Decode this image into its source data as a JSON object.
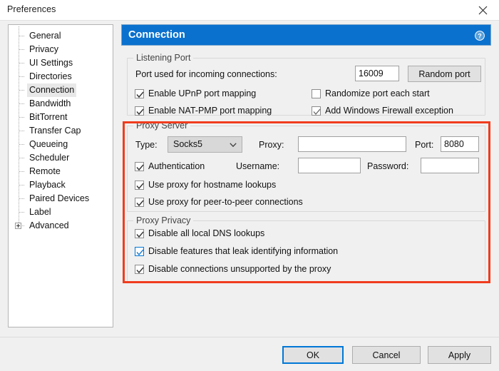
{
  "window": {
    "title": "Preferences",
    "close_icon": "close-icon"
  },
  "sidebar": {
    "items": [
      {
        "label": "General",
        "selected": false,
        "expandable": false
      },
      {
        "label": "Privacy",
        "selected": false,
        "expandable": false
      },
      {
        "label": "UI Settings",
        "selected": false,
        "expandable": false
      },
      {
        "label": "Directories",
        "selected": false,
        "expandable": false
      },
      {
        "label": "Connection",
        "selected": true,
        "expandable": false
      },
      {
        "label": "Bandwidth",
        "selected": false,
        "expandable": false
      },
      {
        "label": "BitTorrent",
        "selected": false,
        "expandable": false
      },
      {
        "label": "Transfer Cap",
        "selected": false,
        "expandable": false
      },
      {
        "label": "Queueing",
        "selected": false,
        "expandable": false
      },
      {
        "label": "Scheduler",
        "selected": false,
        "expandable": false
      },
      {
        "label": "Remote",
        "selected": false,
        "expandable": false
      },
      {
        "label": "Playback",
        "selected": false,
        "expandable": false
      },
      {
        "label": "Paired Devices",
        "selected": false,
        "expandable": false
      },
      {
        "label": "Label",
        "selected": false,
        "expandable": false
      },
      {
        "label": "Advanced",
        "selected": false,
        "expandable": true
      }
    ]
  },
  "content": {
    "header": {
      "title": "Connection",
      "help_icon": "help-question-icon",
      "background_color": "#0b71ce"
    },
    "listening_port": {
      "group_title": "Listening Port",
      "port_label": "Port used for incoming connections:",
      "port_value": "16009",
      "random_port_button": "Random port",
      "checkboxes": [
        {
          "label": "Enable UPnP port mapping",
          "checked": true,
          "focused": false
        },
        {
          "label": "Randomize port each start",
          "checked": false,
          "focused": false
        },
        {
          "label": "Enable NAT-PMP port mapping",
          "checked": true,
          "focused": false
        },
        {
          "label": "Add Windows Firewall exception",
          "checked": true,
          "focused": false
        }
      ]
    },
    "proxy_server": {
      "group_title": "Proxy Server",
      "type_label": "Type:",
      "type_value": "Socks5",
      "proxy_label": "Proxy:",
      "proxy_value": "",
      "port_label": "Port:",
      "port_value": "8080",
      "username_label": "Username:",
      "username_value": "",
      "password_label": "Password:",
      "password_value": "",
      "checkboxes": [
        {
          "label": "Authentication",
          "checked": true,
          "focused": false
        },
        {
          "label": "Use proxy for hostname lookups",
          "checked": true,
          "focused": false
        },
        {
          "label": "Use proxy for peer-to-peer connections",
          "checked": true,
          "focused": false
        }
      ]
    },
    "proxy_privacy": {
      "group_title": "Proxy Privacy",
      "checkboxes": [
        {
          "label": "Disable all local DNS lookups",
          "checked": true,
          "focused": false
        },
        {
          "label": "Disable features that leak identifying information",
          "checked": true,
          "focused": true
        },
        {
          "label": "Disable connections unsupported by the proxy",
          "checked": true,
          "focused": false
        }
      ]
    }
  },
  "annotation": {
    "color": "#f03c1e"
  },
  "footer": {
    "ok_label": "OK",
    "cancel_label": "Cancel",
    "apply_label": "Apply"
  }
}
